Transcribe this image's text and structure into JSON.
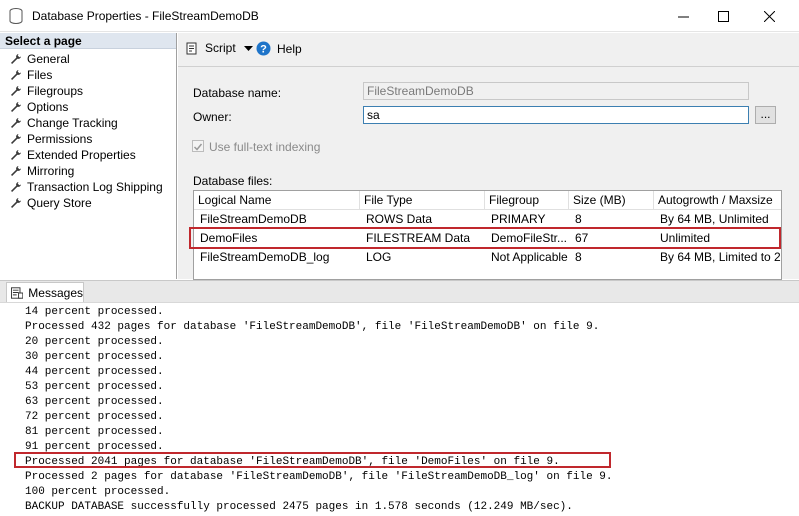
{
  "window": {
    "title": "Database Properties - FileStreamDemoDB",
    "minimize": "—",
    "maximize": "☐",
    "close": "✕"
  },
  "left": {
    "header": "Select a page",
    "items": [
      {
        "label": "General"
      },
      {
        "label": "Files"
      },
      {
        "label": "Filegroups"
      },
      {
        "label": "Options"
      },
      {
        "label": "Change Tracking"
      },
      {
        "label": "Permissions"
      },
      {
        "label": "Extended Properties"
      },
      {
        "label": "Mirroring"
      },
      {
        "label": "Transaction Log Shipping"
      },
      {
        "label": "Query Store"
      }
    ]
  },
  "toolbar": {
    "script_label": "Script",
    "help_label": "Help"
  },
  "form": {
    "db_name_label": "Database name:",
    "db_name_value": "FileStreamDemoDB",
    "owner_label": "Owner:",
    "owner_value": "sa",
    "browse_label": "...",
    "fulltext_label": "Use full-text indexing",
    "files_label": "Database files:"
  },
  "grid": {
    "columns": [
      "Logical Name",
      "File Type",
      "Filegroup",
      "Size (MB)",
      "Autogrowth / Maxsize"
    ],
    "rows": [
      [
        "FileStreamDemoDB",
        "ROWS Data",
        "PRIMARY",
        "8",
        "By 64 MB, Unlimited"
      ],
      [
        "DemoFiles",
        "FILESTREAM Data",
        "DemoFileStr...",
        "67",
        "Unlimited"
      ],
      [
        "FileStreamDemoDB_log",
        "LOG",
        "Not Applicable",
        "8",
        "By 64 MB, Limited to 2..."
      ]
    ]
  },
  "messages": {
    "tab_label": "Messages",
    "lines": [
      "14 percent processed.",
      "Processed 432 pages for database 'FileStreamDemoDB', file 'FileStreamDemoDB' on file 9.",
      "20 percent processed.",
      "30 percent processed.",
      "44 percent processed.",
      "53 percent processed.",
      "63 percent processed.",
      "72 percent processed.",
      "81 percent processed.",
      "91 percent processed.",
      "Processed 2041 pages for database 'FileStreamDemoDB', file 'DemoFiles' on file 9.",
      "Processed 2 pages for database 'FileStreamDemoDB', file 'FileStreamDemoDB_log' on file 9.",
      "100 percent processed.",
      "BACKUP DATABASE successfully processed 2475 pages in 1.578 seconds (12.249 MB/sec)."
    ]
  },
  "colors": {
    "highlight": "#c0282d",
    "left_header_bg": "#dfe6ef",
    "active_border": "#3c7fb1"
  }
}
